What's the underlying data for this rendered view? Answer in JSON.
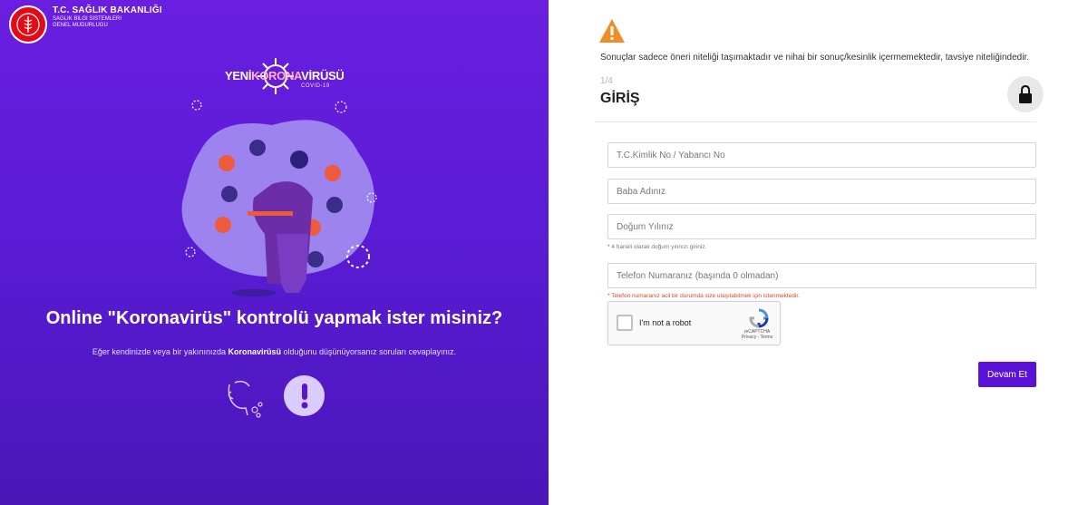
{
  "brand": {
    "title": "T.C. SAĞLIK BAKANLIĞI",
    "sub1": "SAĞLIK BİLGİ SİSTEMLERİ",
    "sub2": "GENEL MÜDÜRLÜĞÜ"
  },
  "campaign": {
    "word1": "YENİ",
    "word2": "KORONA",
    "word3": "VİRÜSÜ",
    "tag": "COVID-19"
  },
  "left": {
    "headline": "Online \"Koronavirüs\" kontrolü yapmak ister misiniz?",
    "sub_pre": "Eğer kendinizde veya bir yakınınızda ",
    "sub_bold": "Koronavirüsü",
    "sub_post": " olduğunu düşünüyorsanız soruları cevaplayınız."
  },
  "right": {
    "warning": "Sonuçlar sadece öneri niteliği taşımaktadır ve nihai bir sonuç/kesinlik içermemektedir, tavsiye niteliğindedir.",
    "step": "1/4",
    "title": "GİRİŞ",
    "fields": {
      "tc_placeholder": "T.C.Kimlik No / Yabancı No",
      "father_placeholder": "Baba Adınız",
      "birth_placeholder": "Doğum Yılınız",
      "birth_hint": "* 4 haneli olarak doğum yılınızı giriniz.",
      "phone_placeholder": "Telefon Numaranız (başında 0 olmadan)",
      "phone_hint": "* Telefon numaranız acil bir durumda size ulaşılabilmek için istenmektedir."
    },
    "captcha": {
      "label": "I'm not a robot",
      "brand": "reCAPTCHA",
      "links": "Privacy - Terms"
    },
    "submit": "Devam Et"
  },
  "colors": {
    "primary": "#5a12d8",
    "warning": "#f28c28",
    "brand_red": "#e30a17"
  },
  "icons": [
    "ministry-logo-icon",
    "virus-icon",
    "warning-icon",
    "lock-icon",
    "cough-icon",
    "alert-icon",
    "recaptcha-icon"
  ]
}
